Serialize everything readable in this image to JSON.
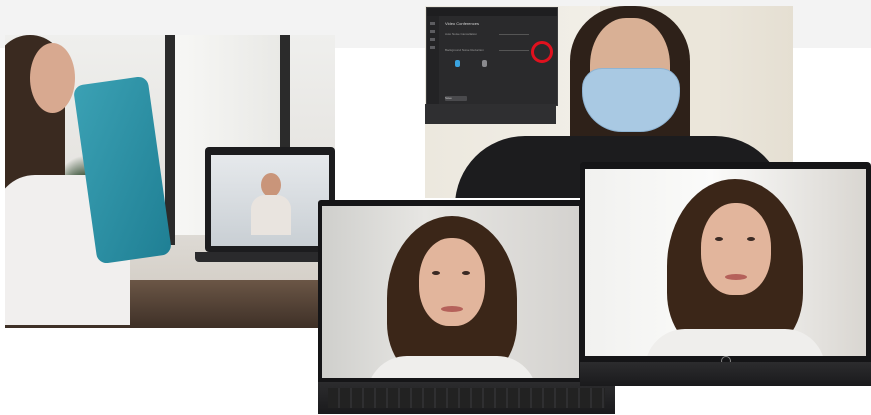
{
  "collage": {
    "dialog": {
      "title": "Video Conferences",
      "rows": [
        "Auto Noise Cancellation",
        "Background Noise Reduction"
      ],
      "button_label": "Save",
      "brand": "hp"
    }
  },
  "colors": {
    "highlight_ring": "#e0111e",
    "towel": "#2a92a8",
    "mask": "#a9c9e3"
  }
}
